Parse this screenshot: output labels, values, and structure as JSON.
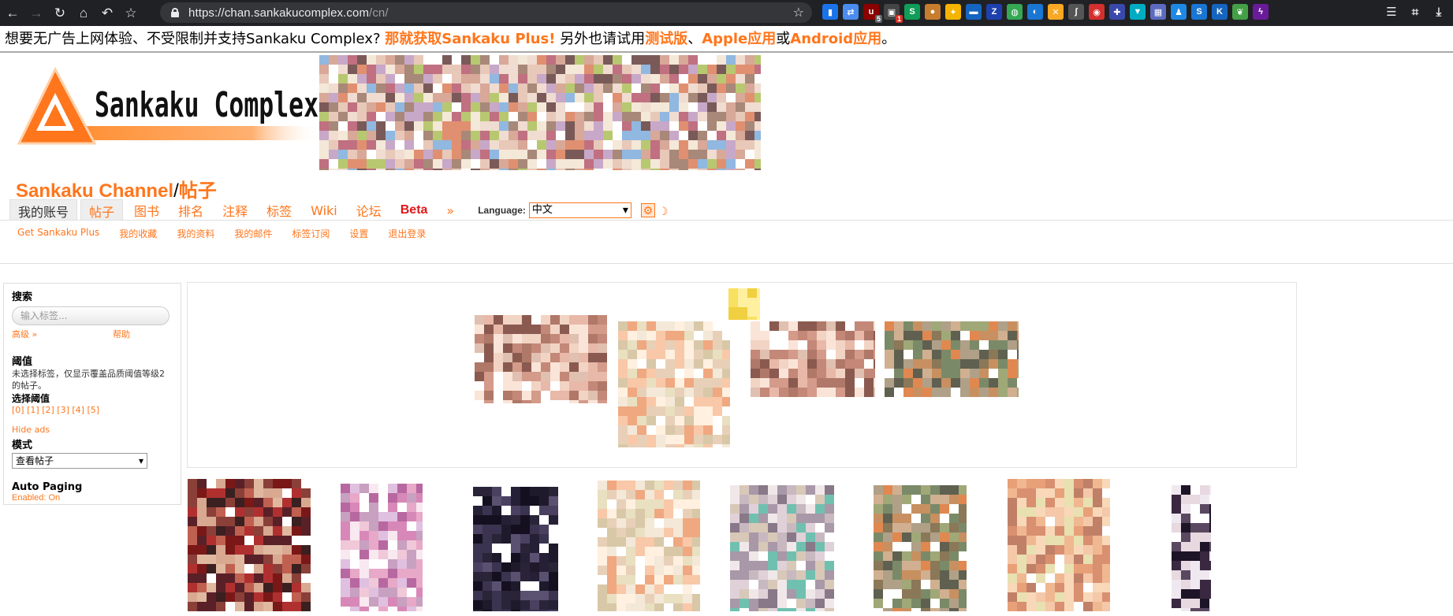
{
  "browser": {
    "url_host": "https://chan.sankakucomplex.com",
    "url_path": "/cn/",
    "extension_badges": [
      "5",
      "1"
    ]
  },
  "notice": {
    "lead": "想要无广告上网体验、不受限制并支持Sankaku Complex?",
    "plus_link": "那就获取Sankaku Plus!",
    "mid": "另外也请试用",
    "beta_link": "测试版",
    "sep": "、",
    "apple_link": "Apple应用",
    "or": "或",
    "android_link": "Android应用",
    "end": "。"
  },
  "header": {
    "logo_text": "Sankaku Complex",
    "site_name": "Sankaku Channel",
    "separator": "/",
    "section": "帖子"
  },
  "nav": {
    "tabs": [
      "我的账号",
      "帖子",
      "图书",
      "排名",
      "注释",
      "标签",
      "Wiki",
      "论坛",
      "Beta",
      "»"
    ],
    "language_label": "Language:",
    "language_value": "中文"
  },
  "subnav": {
    "items": [
      "Get Sankaku Plus",
      "我的收藏",
      "我的资料",
      "我的邮件",
      "标签订阅",
      "设置",
      "退出登录"
    ]
  },
  "sidebar": {
    "search_heading": "搜索",
    "search_placeholder": "输入标签...",
    "advanced_link": "高级 »",
    "help_link": "帮助",
    "threshold_heading": "阈值",
    "threshold_desc": "未选择标签，仅显示覆盖品质阈值等级2的帖子。",
    "select_threshold_label": "选择阈值",
    "levels": [
      "[0]",
      "[1]",
      "[2]",
      "[3]",
      "[4]",
      "[5]"
    ],
    "hide_ads": "Hide ads",
    "mode_heading": "模式",
    "mode_value": "查看帖子",
    "autopaging_heading": "Auto Paging",
    "autopaging_status": "Enabled: On"
  },
  "colors": {
    "accent": "#ff761c",
    "beta": "#e01818",
    "chrome_bg": "#202124",
    "omnibox_bg": "#35363a"
  }
}
